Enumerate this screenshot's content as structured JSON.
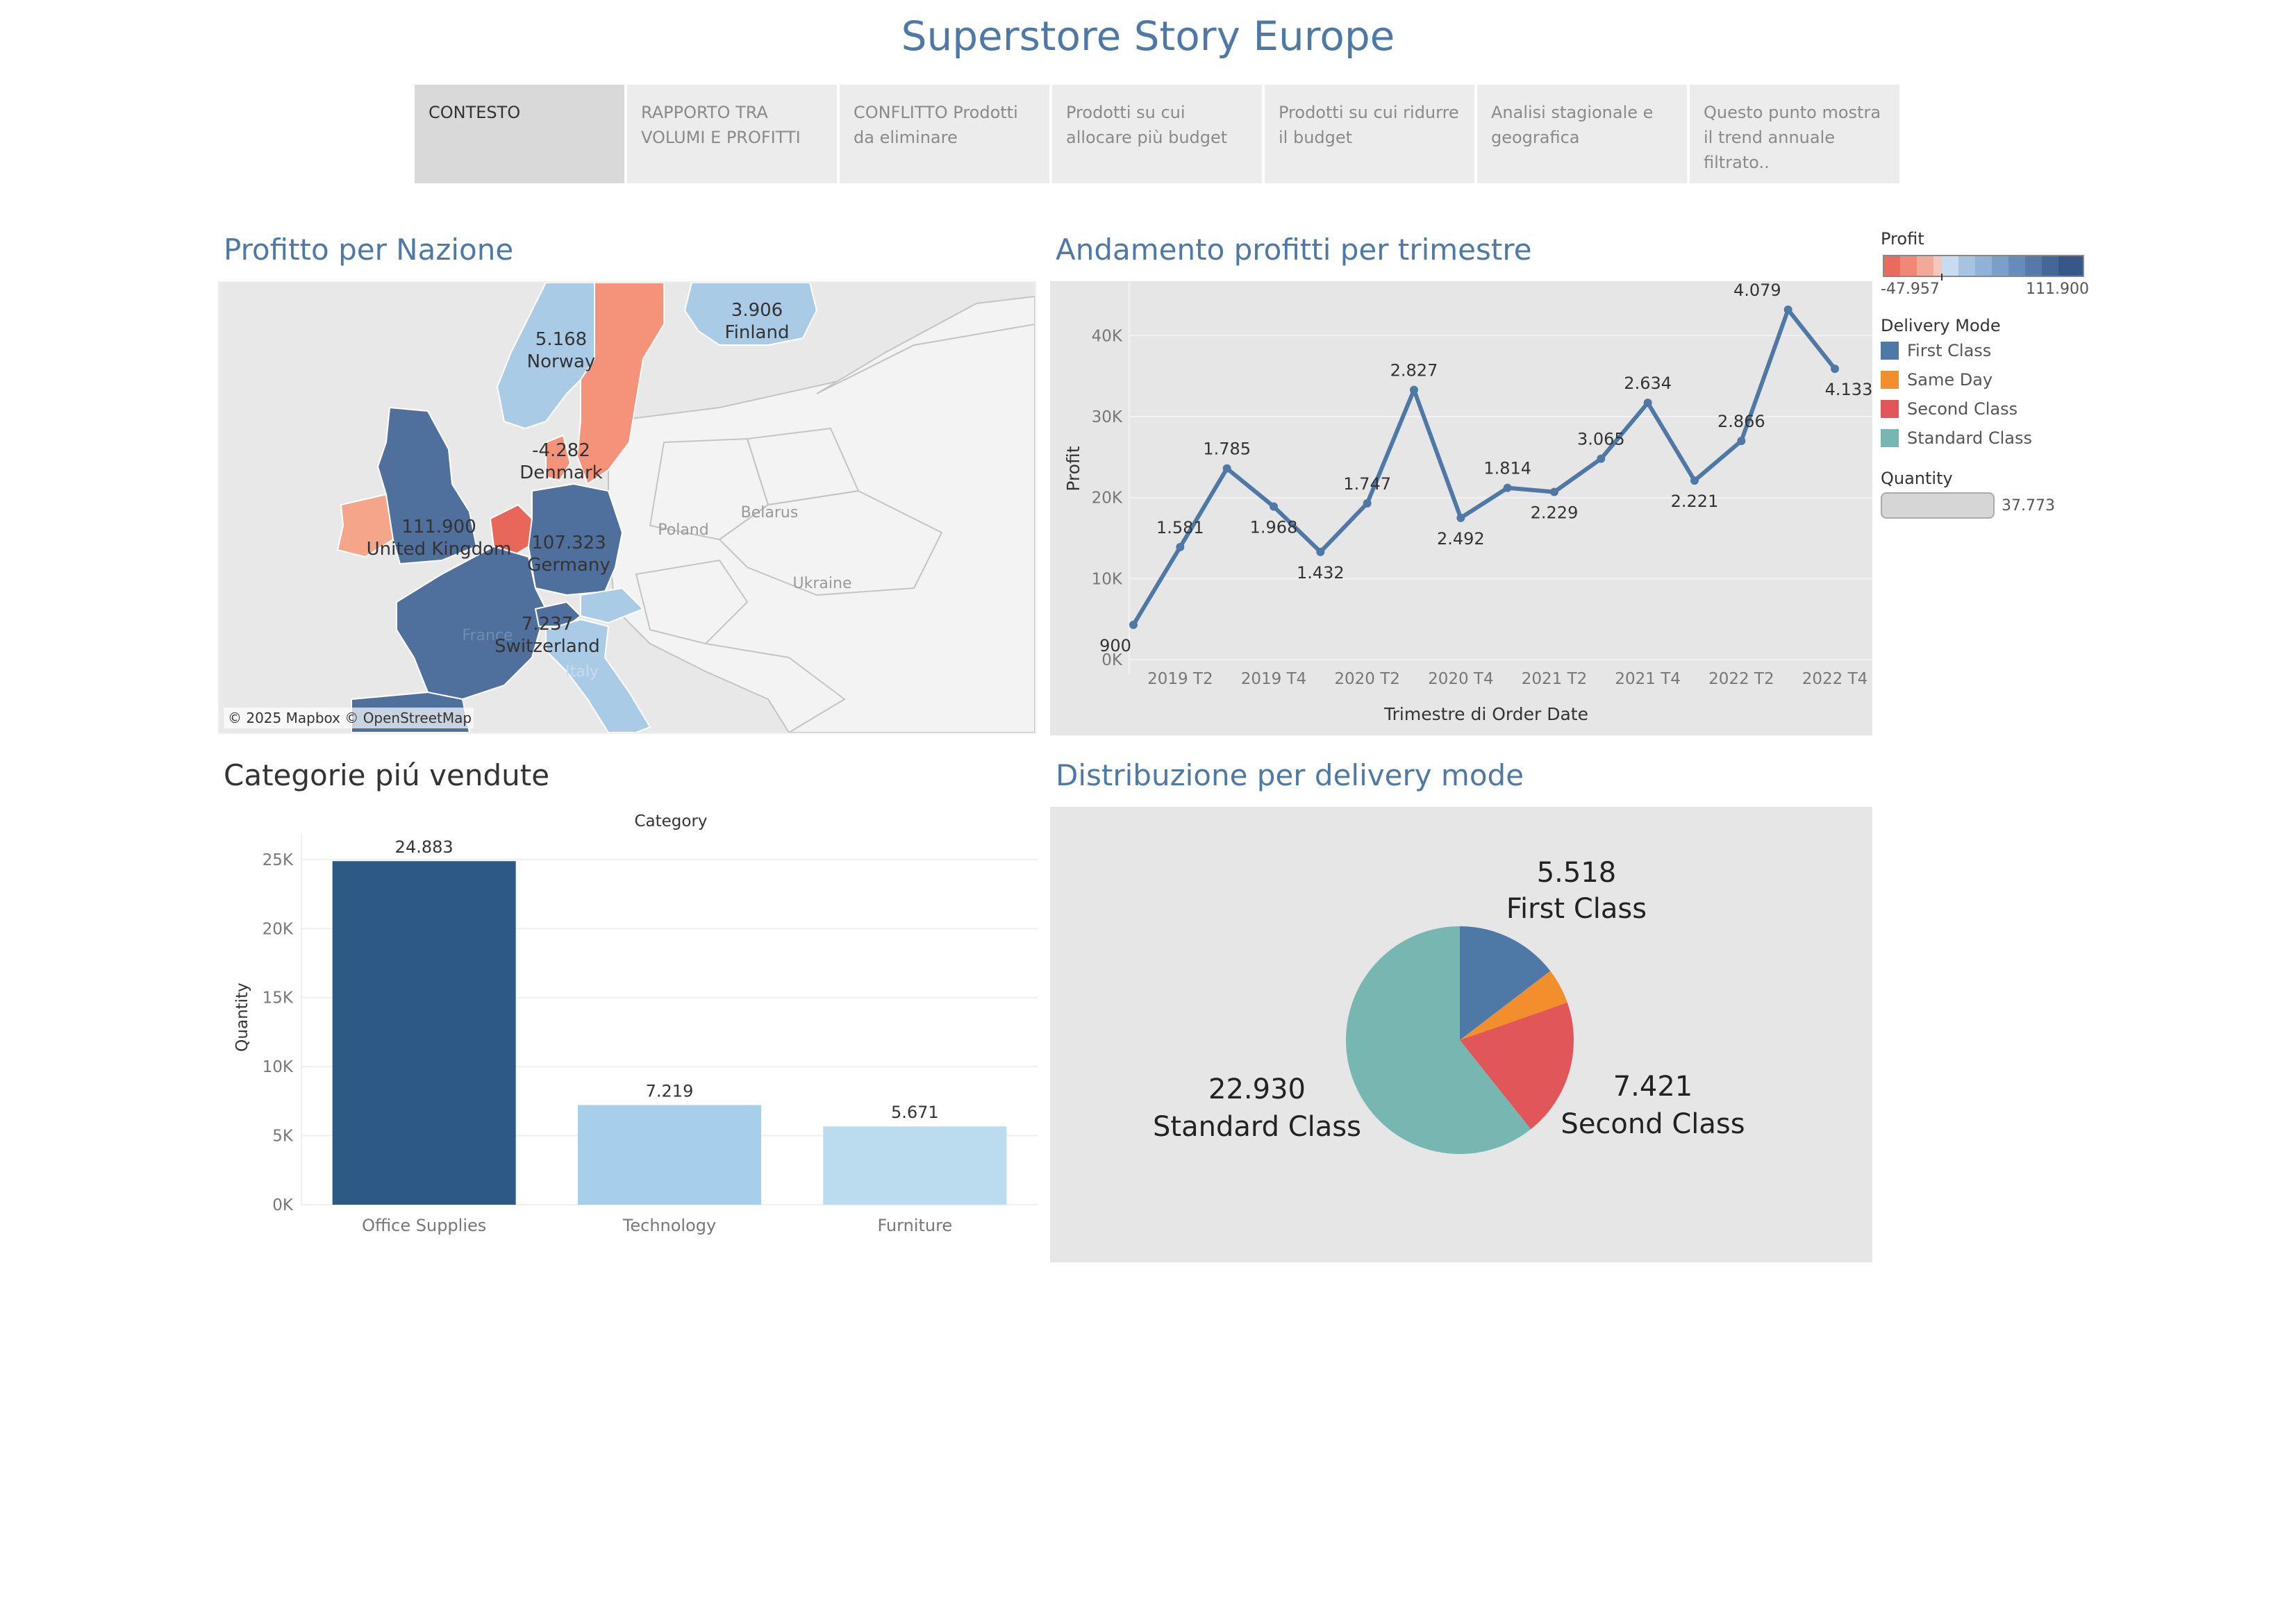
{
  "story_title": "Superstore Story Europe",
  "nav_tabs": [
    {
      "label": "CONTESTO"
    },
    {
      "label": "RAPPORTO TRA VOLUMI E PROFITTI"
    },
    {
      "label": "CONFLITTO     Prodotti da eliminare"
    },
    {
      "label": "Prodotti su cui allocare più budget"
    },
    {
      "label": "Prodotti su cui ridurre il budget"
    },
    {
      "label": "Analisi stagionale e geografica"
    },
    {
      "label": "Questo punto mostra il trend annuale filtrato.."
    }
  ],
  "map": {
    "title": "Profitto per Nazione",
    "attribution": "© 2025 Mapbox © OpenStreetMap",
    "countries": [
      {
        "name": "Finland",
        "value": "3.906"
      },
      {
        "name": "Norway",
        "value": "5.168"
      },
      {
        "name": "Denmark",
        "value": "-4.282"
      },
      {
        "name": "United Kingdom",
        "value": "111.900"
      },
      {
        "name": "Germany",
        "value": "107.323"
      },
      {
        "name": "Switzerland",
        "value": "7.237"
      }
    ],
    "base_labels": [
      "Poland",
      "Belarus",
      "Ukraine",
      "France",
      "Italy"
    ]
  },
  "legend": {
    "profit_title": "Profit",
    "profit_min": "-47.957",
    "profit_max": "111.900",
    "delivery_title": "Delivery Mode",
    "delivery_items": [
      {
        "label": "First Class",
        "color": "#4e79a7"
      },
      {
        "label": "Same Day",
        "color": "#f28e2b"
      },
      {
        "label": "Second Class",
        "color": "#e15759"
      },
      {
        "label": "Standard Class",
        "color": "#76b7b2"
      }
    ],
    "quantity_title": "Quantity",
    "quantity_value": "37.773"
  },
  "line_chart": {
    "title": "Andamento profitti per trimestre",
    "xlabel": "Trimestre di Order Date",
    "ylabel": "Profit"
  },
  "bar_chart": {
    "title": "Categorie piú vendute",
    "header": "Category",
    "ylabel": "Quantity"
  },
  "pie_chart": {
    "title": "Distribuzione per delivery mode"
  },
  "chart_data": [
    {
      "type": "line",
      "title": "Andamento profitti per trimestre",
      "xlabel": "Trimestre di Order Date",
      "ylabel": "Profit",
      "x": [
        "2019 T1",
        "2019 T2",
        "2019 T3",
        "2019 T4",
        "2020 T1",
        "2020 T2",
        "2020 T3",
        "2020 T4",
        "2021 T1",
        "2021 T2",
        "2021 T3",
        "2021 T4",
        "2022 T1",
        "2022 T2",
        "2022 T3",
        "2022 T4"
      ],
      "xticks": [
        "2019 T2",
        "2019 T4",
        "2020 T2",
        "2020 T4",
        "2021 T2",
        "2021 T4",
        "2022 T2",
        "2022 T4"
      ],
      "yticks": [
        "0K",
        "10K",
        "20K",
        "30K",
        "40K"
      ],
      "ylim": [
        0,
        45000
      ],
      "values": [
        4300,
        13900,
        23600,
        18900,
        13300,
        19300,
        33300,
        17500,
        21200,
        20700,
        24800,
        31700,
        22100,
        27000,
        43200,
        35900
      ],
      "labels": [
        "900",
        "1.581",
        "1.785",
        "1.968",
        "1.432",
        "1.747",
        "2.827",
        "2.492",
        "1.814",
        "2.229",
        "3.065",
        "2.634",
        "2.221",
        "2.866",
        "4.079",
        "4.133"
      ],
      "color": "#4e79a7"
    },
    {
      "type": "bar",
      "title": "Categorie piú vendute",
      "header": "Category",
      "ylabel": "Quantity",
      "categories": [
        "Office Supplies",
        "Technology",
        "Furniture"
      ],
      "values": [
        24883,
        7219,
        5671
      ],
      "labels": [
        "24.883",
        "7.219",
        "5.671"
      ],
      "yticks": [
        "0K",
        "5K",
        "10K",
        "15K",
        "20K",
        "25K"
      ],
      "ylim": [
        0,
        26000
      ],
      "colors": [
        "#2c5985",
        "#a6cfec",
        "#bbdbef"
      ]
    },
    {
      "type": "pie",
      "title": "Distribuzione per delivery mode",
      "slices": [
        {
          "label": "First Class",
          "value": 5518,
          "value_label": "5.518",
          "color": "#4e79a7"
        },
        {
          "label": "Same Day",
          "value": 1904,
          "value_label": "",
          "color": "#f28e2b"
        },
        {
          "label": "Second Class",
          "value": 7421,
          "value_label": "7.421",
          "color": "#e15759"
        },
        {
          "label": "Standard Class",
          "value": 22930,
          "value_label": "22.930",
          "color": "#76b7b2"
        }
      ]
    }
  ]
}
